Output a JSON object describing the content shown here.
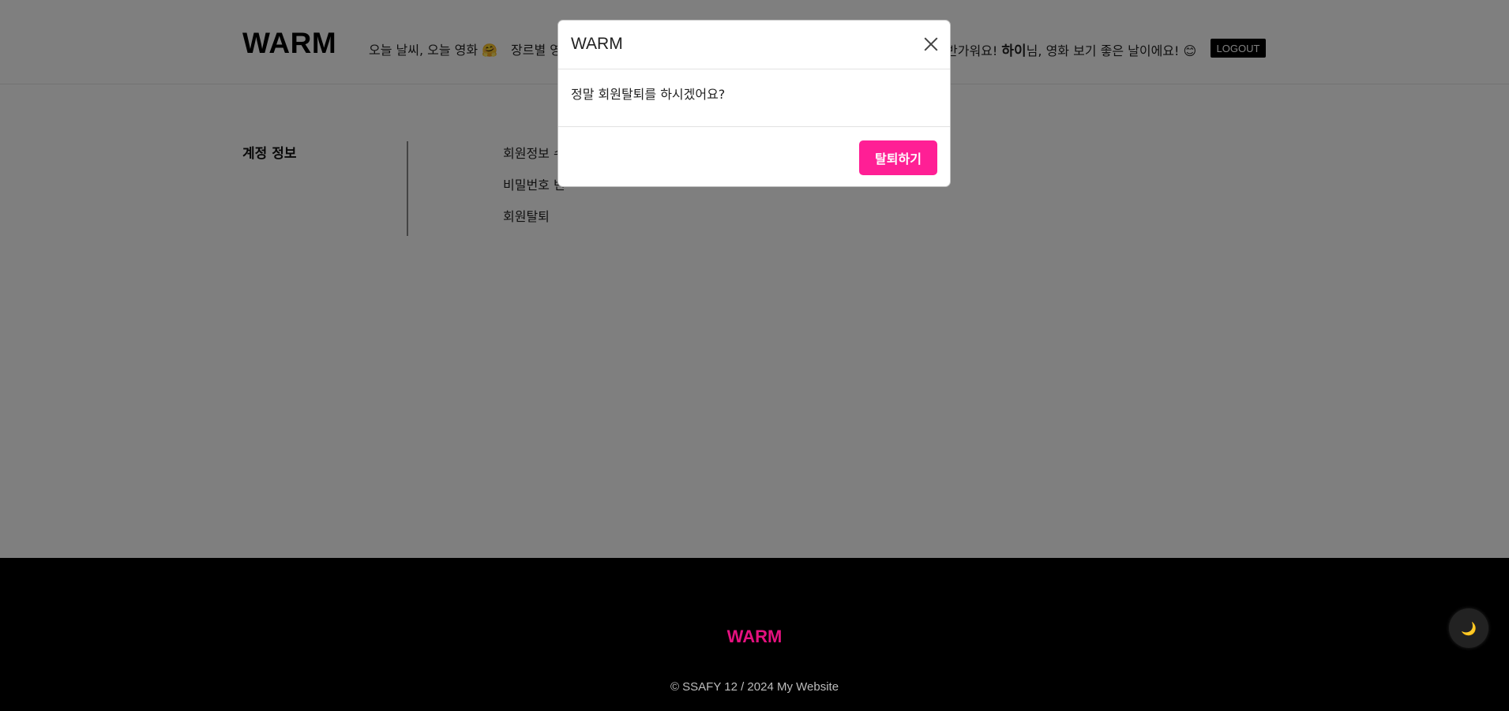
{
  "header": {
    "logo": "WARM",
    "nav": [
      "오늘 날씨, 오늘 영화 🤗",
      "장르별 영"
    ],
    "greeting_prefix": "반가워요! ",
    "username": "하이",
    "greeting_suffix": "님, 영화 보기 좋은 날이에요! 😊",
    "logout_label": "LOGOUT"
  },
  "sidebar": {
    "title": "계정 정보"
  },
  "account_menu": {
    "items": [
      "회원정보 수",
      "비밀번호 변",
      "회원탈퇴"
    ]
  },
  "modal": {
    "title": "WARM",
    "message": "정말 회원탈퇴를 하시겠어요?",
    "confirm_label": "탈퇴하기",
    "confirm_color": "#ff1f95"
  },
  "footer": {
    "logo": "WARM",
    "logo_color": "#e4117f",
    "copyright": "© SSAFY 12 / 2024 My Website"
  },
  "theme_toggle": {
    "icon": "moon-icon",
    "glyph": "🌙"
  }
}
